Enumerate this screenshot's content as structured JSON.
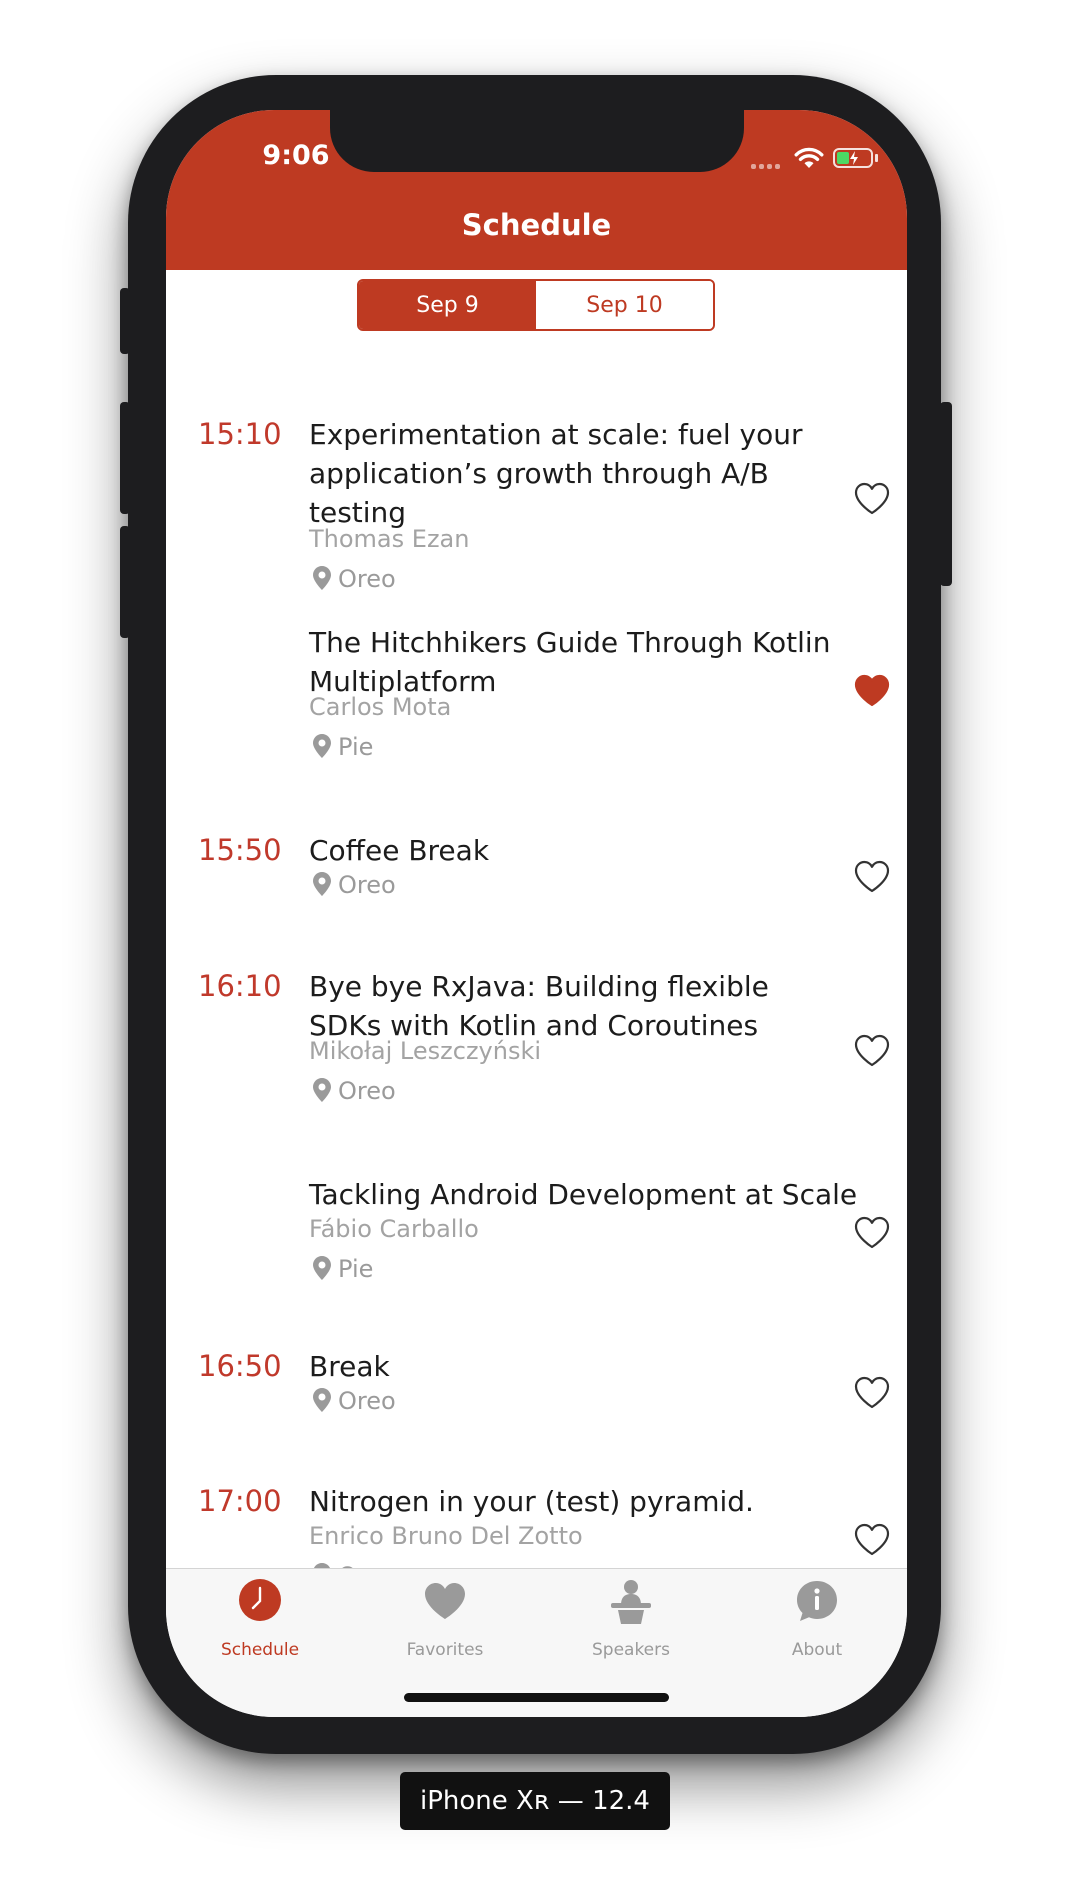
{
  "status_bar": {
    "time": "9:06"
  },
  "header": {
    "title": "Schedule"
  },
  "day_selector": {
    "options": [
      "Sep 9",
      "Sep 10"
    ],
    "selected": "Sep 9"
  },
  "sessions": [
    {
      "time": "15:10",
      "title": "Experimentation at scale: fuel your application’s growth through A/B testing",
      "speaker": "Thomas Ezan",
      "room": "Oreo",
      "favorite": false
    },
    {
      "time": "",
      "title": "The Hitchhikers Guide Through Kotlin Multiplatform",
      "speaker": "Carlos Mota",
      "room": "Pie",
      "favorite": true
    },
    {
      "time": "15:50",
      "title": "Coffee Break",
      "speaker": "",
      "room": "Oreo",
      "favorite": false
    },
    {
      "time": "16:10",
      "title": "Bye bye RxJava: Building flexible SDKs with Kotlin and Coroutines",
      "speaker": "Mikołaj Leszczyński",
      "room": "Oreo",
      "favorite": false
    },
    {
      "time": "",
      "title": "Tackling Android Development at Scale",
      "speaker": "Fábio Carballo",
      "room": "Pie",
      "favorite": false
    },
    {
      "time": "16:50",
      "title": "Break",
      "speaker": "",
      "room": "Oreo",
      "favorite": false
    },
    {
      "time": "17:00",
      "title": "Nitrogen in your (test) pyramid.",
      "speaker": "Enrico Bruno Del Zotto",
      "room": "Oreo",
      "favorite": false
    }
  ],
  "tabs": [
    {
      "label": "Schedule",
      "icon": "clock-icon",
      "active": true
    },
    {
      "label": "Favorites",
      "icon": "heart-icon",
      "active": false
    },
    {
      "label": "Speakers",
      "icon": "speaker-podium-icon",
      "active": false
    },
    {
      "label": "About",
      "icon": "info-bubble-icon",
      "active": false
    }
  ],
  "device_label": "iPhone Xʀ — 12.4",
  "colors": {
    "accent": "#be3a22",
    "time_text": "#c0392b",
    "secondary_text": "#a3a3a3",
    "tab_inactive": "#9a9a9a"
  }
}
